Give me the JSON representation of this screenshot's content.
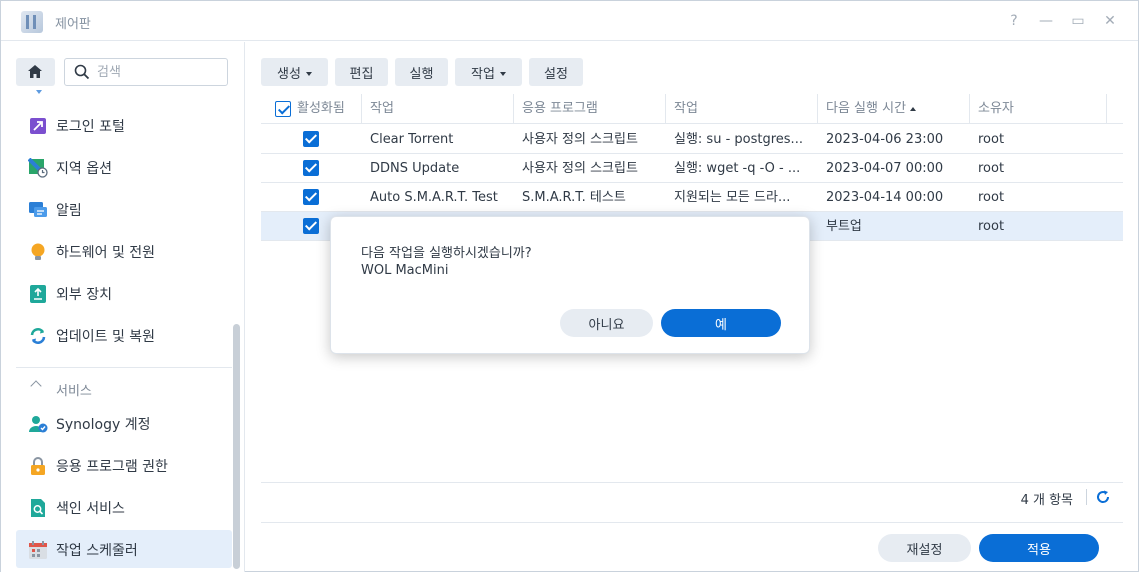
{
  "window": {
    "title": "제어판",
    "help": "?",
    "minimize": "—",
    "maximize": "▭",
    "close": "✕"
  },
  "sidebar": {
    "search_placeholder": "검색",
    "items": [
      {
        "label": "로그인 포털"
      },
      {
        "label": "지역 옵션"
      },
      {
        "label": "알림"
      },
      {
        "label": "하드웨어 및 전원"
      },
      {
        "label": "외부 장치"
      },
      {
        "label": "업데이트 및 복원"
      }
    ],
    "section": "서비스",
    "service_items": [
      {
        "label": "Synology 계정"
      },
      {
        "label": "응용 프로그램 권한"
      },
      {
        "label": "색인 서비스"
      },
      {
        "label": "작업 스케줄러"
      }
    ]
  },
  "toolbar": {
    "create": "생성",
    "edit": "편집",
    "run": "실행",
    "action": "작업",
    "settings": "설정"
  },
  "table": {
    "columns": [
      "활성화됨",
      "작업",
      "응용 프로그램",
      "작업",
      "다음 실행 시간",
      "소유자"
    ],
    "rows": [
      {
        "task": "Clear Torrent",
        "app": "사용자 정의 스크립트",
        "action": "실행: su - postgres...",
        "next": "2023-04-06 23:00",
        "owner": "root"
      },
      {
        "task": "DDNS Update",
        "app": "사용자 정의 스크립트",
        "action": "실행: wget -q -O - ...",
        "next": "2023-04-07 00:00",
        "owner": "root"
      },
      {
        "task": "Auto S.M.A.R.T. Test",
        "app": "S.M.A.R.T. 테스트",
        "action": "지원되는 모든 드라...",
        "next": "2023-04-14 00:00",
        "owner": "root"
      },
      {
        "task": "",
        "app": "",
        "action": "",
        "next": "부트업",
        "owner": "root"
      }
    ]
  },
  "footer": {
    "count": "4 개 항목"
  },
  "actions": {
    "reset": "재설정",
    "apply": "적용"
  },
  "dialog": {
    "question": "다음 작업을 실행하시겠습니까?",
    "task_name": "WOL MacMini",
    "no": "아니요",
    "yes": "예"
  },
  "colors": {
    "accent": "#0a6ed6",
    "selected_row": "#e4eefa",
    "button_grey": "#e7ecf2"
  }
}
